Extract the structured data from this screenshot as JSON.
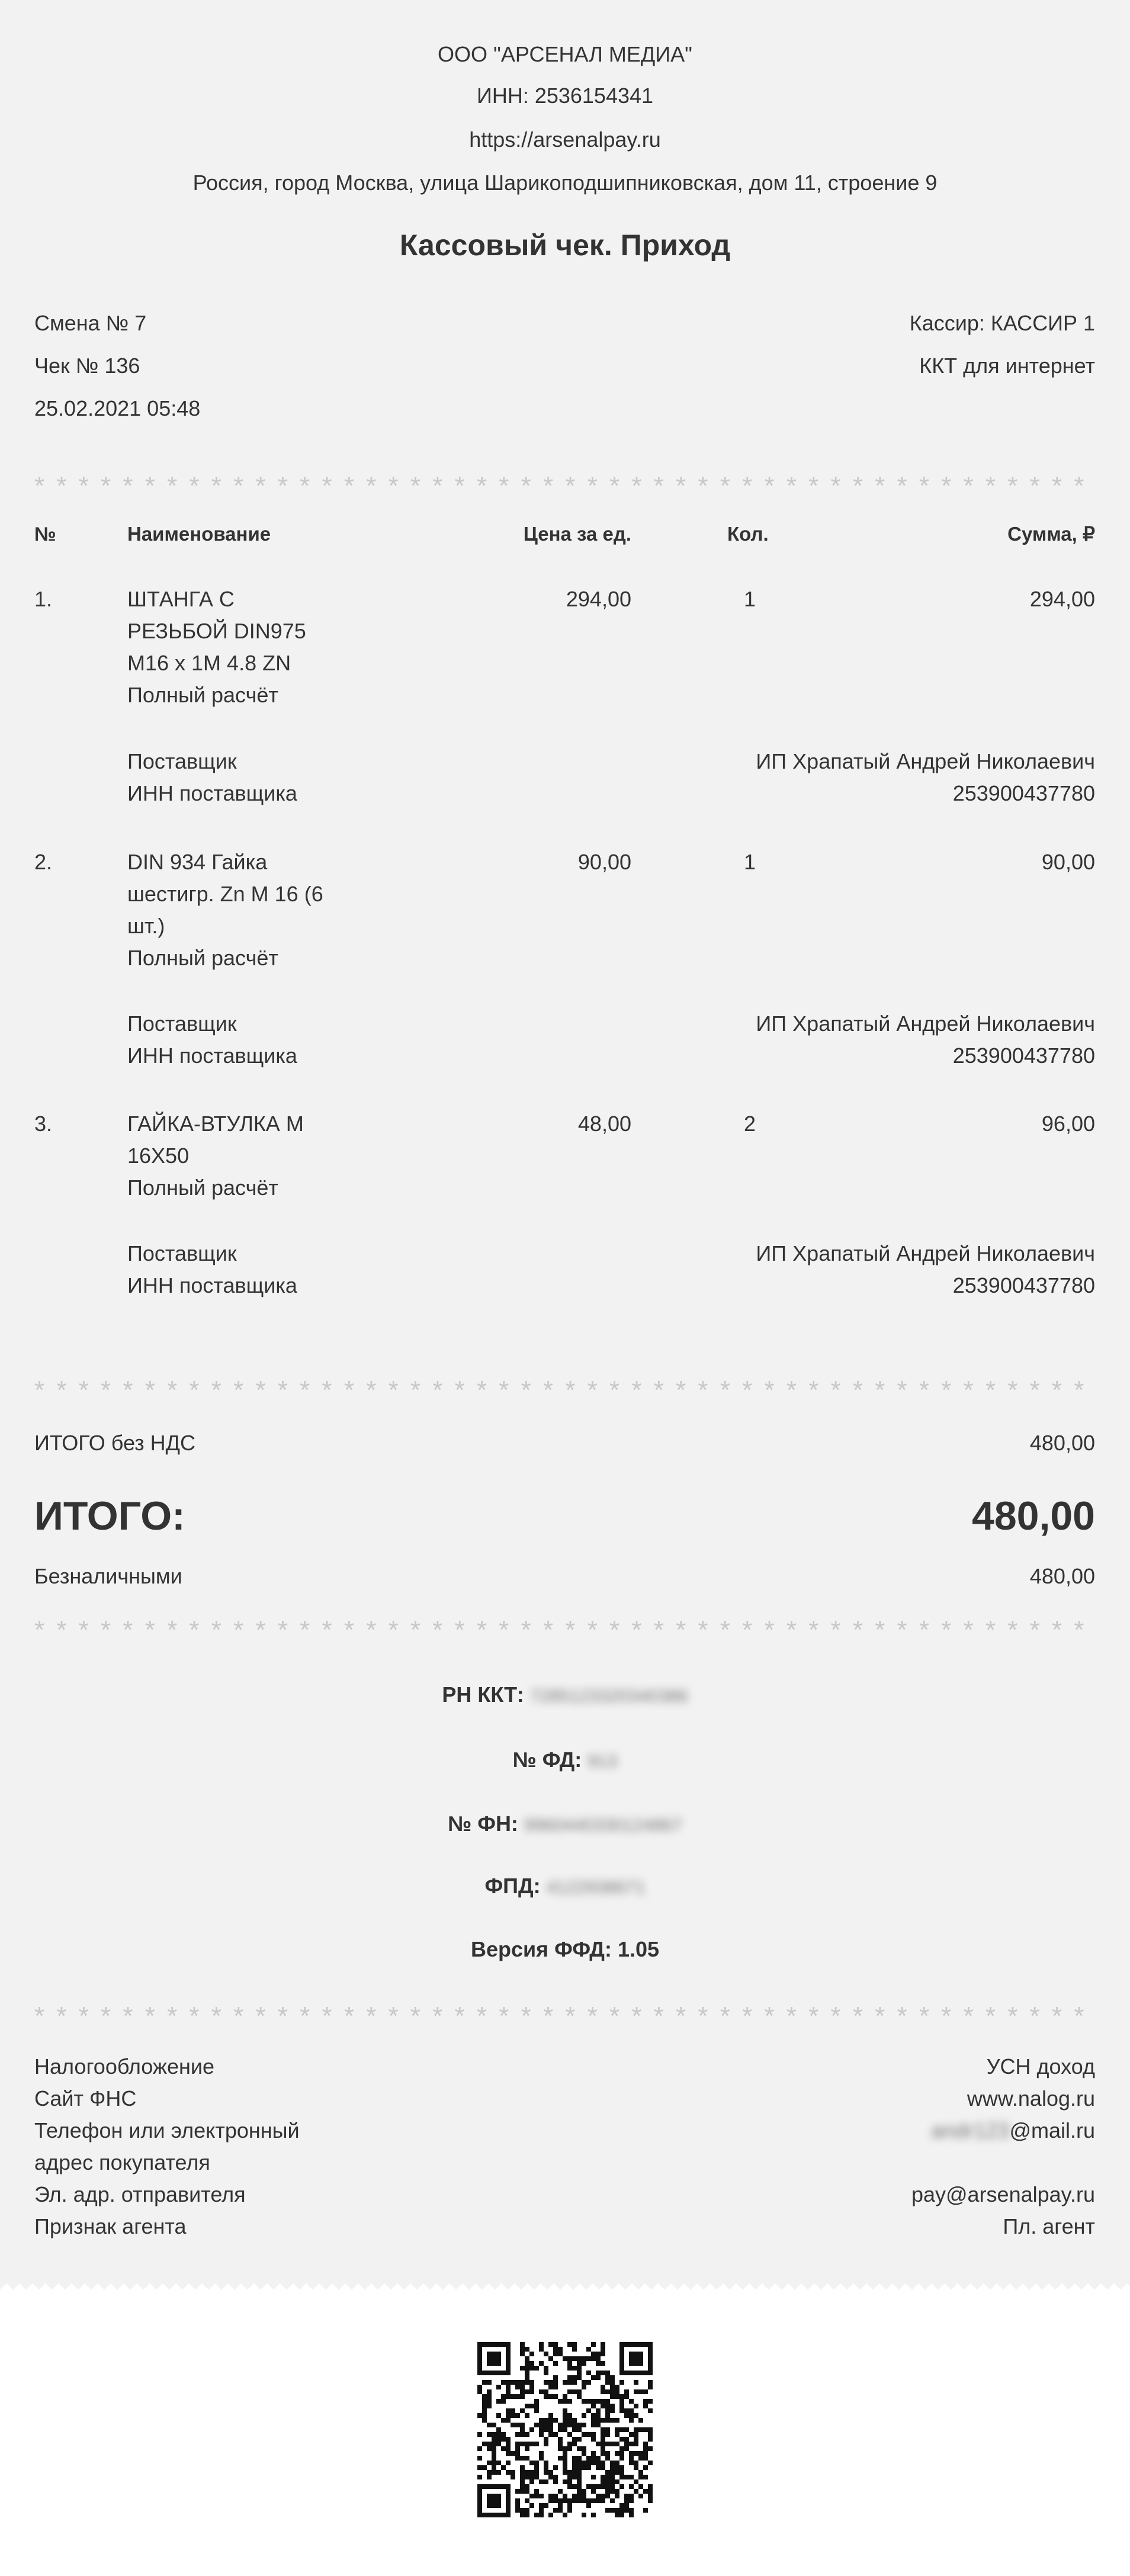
{
  "header": {
    "company": "ООО \"АРСЕНАЛ МЕДИА\"",
    "inn": "ИНН: 2536154341",
    "site": "https://arsenalpay.ru",
    "address": "Россия, город Москва, улица Шарикоподшипниковская, дом 11, строение 9",
    "title": "Кассовый чек. Приход"
  },
  "meta": {
    "shift": "Смена № 7",
    "receipt_no": "Чек № 136",
    "datetime": "25.02.2021 05:48",
    "cashier": "Кассир: КАССИР 1",
    "kkt": "ККТ для интернет"
  },
  "stars": "* * * * * * * * * * * * * * * * * * * * * * * * * * * * * * * * * * * * * * * * * * * * * * * * * * * * * * * * * * * * * * * * * * * * * * * * * * * * *",
  "table": {
    "headers": [
      "№",
      "Наименование",
      "Цена за ед.",
      "Кол.",
      "Сумма, ₽"
    ],
    "items": [
      {
        "num": "1.",
        "name_lines": [
          "ШТАНГА С",
          "РЕЗЬБОЙ DIN975",
          "M16 x 1M 4.8 ZN"
        ],
        "payment": "Полный расчёт",
        "price": "294,00",
        "qty": "1",
        "sum": "294,00",
        "supplier_label": "Поставщик",
        "supplier_inn_label": "ИНН поставщика",
        "supplier": "ИП Храпатый Андрей Николаевич",
        "supplier_inn": "253900437780"
      },
      {
        "num": "2.",
        "name_lines": [
          "DIN 934 Гайка",
          "шестигр. Zn M 16 (6",
          "шт.)"
        ],
        "payment": "Полный расчёт",
        "price": "90,00",
        "qty": "1",
        "sum": "90,00",
        "supplier_label": "Поставщик",
        "supplier_inn_label": "ИНН поставщика",
        "supplier": "ИП Храпатый Андрей Николаевич",
        "supplier_inn": "253900437780"
      },
      {
        "num": "3.",
        "name_lines": [
          "ГАЙКА-ВТУЛКА M",
          "16X50"
        ],
        "payment": "Полный расчёт",
        "price": "48,00",
        "qty": "2",
        "sum": "96,00",
        "supplier_label": "Поставщик",
        "supplier_inn_label": "ИНН поставщика",
        "supplier": "ИП Храпатый Андрей Николаевич",
        "supplier_inn": "253900437780"
      }
    ]
  },
  "totals": {
    "no_vat_label": "ИТОГО без НДС",
    "no_vat_value": "480,00",
    "total_label": "ИТОГО:",
    "total_value": "480,00",
    "cashless_label": "Безналичными",
    "cashless_value": "480,00"
  },
  "fiscal": {
    "rn_label": "РН ККТ:",
    "rn_value": "7285123320340386",
    "fd_label": "№ ФД:",
    "fd_value": "913",
    "fn_label": "№ ФН:",
    "fn_value": "9960440330124867",
    "fpd_label": "ФПД:",
    "fpd_value": "4122938671",
    "ffd_version": "Версия ФФД: 1.05"
  },
  "footer": {
    "rows": [
      {
        "label": "Налогообложение",
        "value": "УСН доход"
      },
      {
        "label": "Сайт ФНС",
        "value": "www.nalog.ru"
      },
      {
        "label": "Телефон или электронный",
        "value_blur": "andr123",
        "value": "@mail.ru"
      },
      {
        "label": "адрес покупателя",
        "value": ""
      },
      {
        "label": "Эл. адр. отправителя",
        "value": "pay@arsenalpay.ru"
      },
      {
        "label": "Признак агента",
        "value": "Пл. агент"
      }
    ]
  }
}
